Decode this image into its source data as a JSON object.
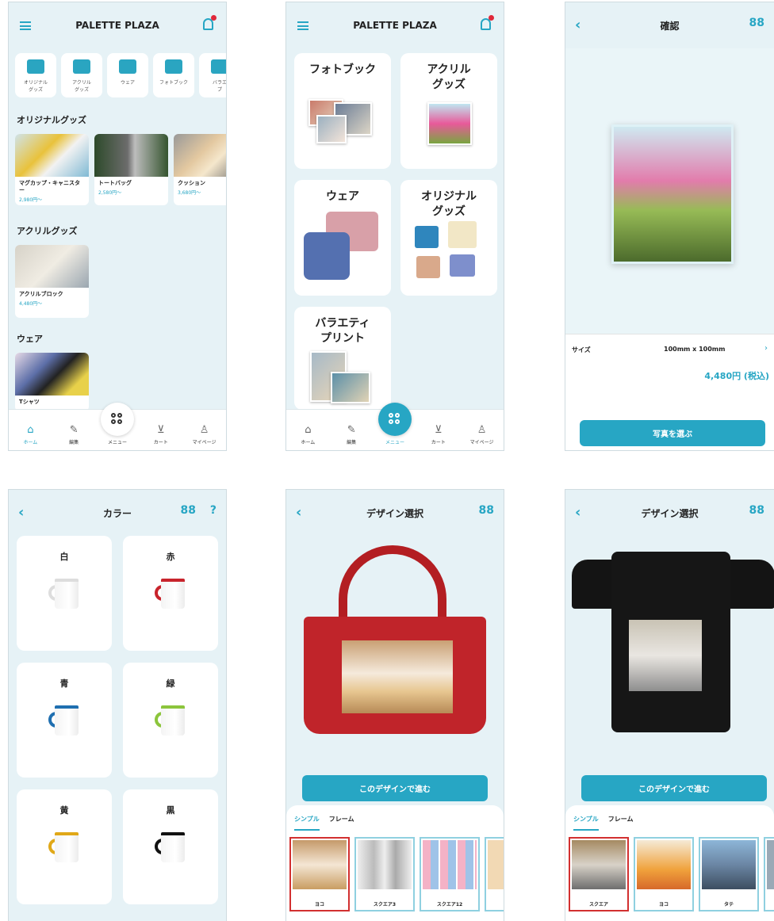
{
  "colors": {
    "accent": "#27a6c4",
    "background": "#e6f2f6",
    "selected_border": "#d23030"
  },
  "tabbar": {
    "home": "ホーム",
    "edit": "編集",
    "menu": "メニュー",
    "cart": "カート",
    "mypage": "マイページ"
  },
  "screen1": {
    "brand": "PALETTE PLAZA",
    "categories": [
      "オリジナル\nグッズ",
      "アクリル\nグッズ",
      "ウェア",
      "フォトブック",
      "バラエ\nプ"
    ],
    "section1": "オリジナルグッズ",
    "items1": [
      {
        "name": "マグカップ・キャニスター",
        "price": "2,980円〜"
      },
      {
        "name": "トートバッグ",
        "price": "2,580円〜"
      },
      {
        "name": "クッション",
        "price": "3,680円〜"
      }
    ],
    "section2": "アクリルグッズ",
    "items2": [
      {
        "name": "アクリルブロック",
        "price": "4,480円〜"
      }
    ],
    "section3": "ウェア",
    "items3": [
      {
        "name": "Tシャツ"
      }
    ]
  },
  "screen2": {
    "brand": "PALETTE PLAZA",
    "cards": [
      "フォトブック",
      "アクリル\nグッズ",
      "ウェア",
      "オリジナル\nグッズ",
      "バラエティ\nプリント"
    ]
  },
  "screen3": {
    "title": "確認",
    "size_label": "サイズ",
    "size_value": "100mm x 100mm",
    "price": "4,480円 (税込)",
    "button": "写真を選ぶ"
  },
  "screen4": {
    "title": "カラー",
    "help": "?",
    "colors": [
      {
        "label": "白",
        "hex": "#dddddd"
      },
      {
        "label": "赤",
        "hex": "#c8242c"
      },
      {
        "label": "青",
        "hex": "#1f6fb0"
      },
      {
        "label": "緑",
        "hex": "#8cc53c"
      },
      {
        "label": "黄",
        "hex": "#e0a818"
      },
      {
        "label": "黒",
        "hex": "#111111"
      }
    ]
  },
  "screen5": {
    "title": "デザイン選択",
    "button": "このデザインで進む",
    "tabs": [
      "シンプル",
      "フレーム"
    ],
    "thumbs": [
      "ヨコ",
      "スクエア3",
      "スクエア12"
    ]
  },
  "screen6": {
    "title": "デザイン選択",
    "button": "このデザインで進む",
    "tabs": [
      "シンプル",
      "フレーム"
    ],
    "thumbs": [
      "スクエア",
      "ヨコ",
      "タテ"
    ]
  }
}
